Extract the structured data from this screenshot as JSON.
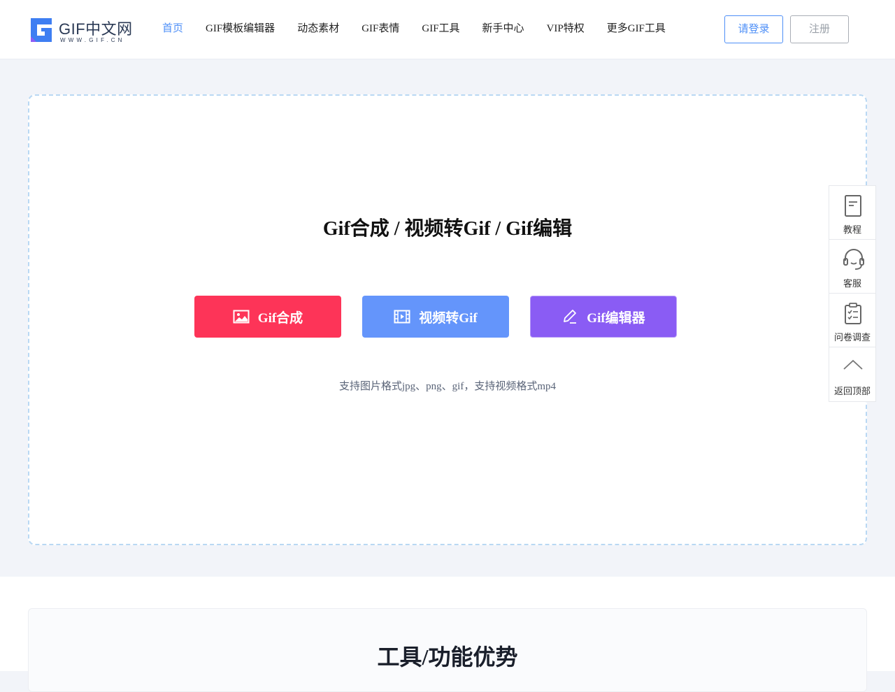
{
  "header": {
    "logo_text": "GIF中文网",
    "logo_sub": "WWW.GIF.CN",
    "nav": [
      {
        "label": "首页",
        "active": true
      },
      {
        "label": "GIF模板编辑器"
      },
      {
        "label": "动态素材"
      },
      {
        "label": "GIF表情"
      },
      {
        "label": "GIF工具"
      },
      {
        "label": "新手中心"
      },
      {
        "label": "VIP特权"
      },
      {
        "label": "更多GIF工具"
      }
    ],
    "login_label": "请登录",
    "register_label": "注册"
  },
  "upload": {
    "title": "Gif合成 / 视频转Gif / Gif编辑",
    "buttons": [
      {
        "label": "Gif合成",
        "icon": "image-icon",
        "color": "#fd3458"
      },
      {
        "label": "视频转Gif",
        "icon": "film-icon",
        "color": "#6495fb"
      },
      {
        "label": "Gif编辑器",
        "icon": "pencil-icon",
        "color": "#8a5cf4"
      }
    ],
    "hint": "支持图片格式jpg、png、gif，支持视频格式mp4"
  },
  "float_bar": {
    "items": [
      {
        "label": "教程",
        "icon": "document-icon"
      },
      {
        "label": "客服",
        "icon": "headset-icon"
      },
      {
        "label": "问卷调查",
        "icon": "clipboard-check-icon"
      },
      {
        "label": "返回顶部",
        "icon": "chevron-up-icon"
      }
    ]
  },
  "features": {
    "title": "工具/功能优势"
  },
  "colors": {
    "accent": "#4e8ff7",
    "compose": "#fd3458",
    "video": "#6495fb",
    "editor": "#8a5cf4"
  }
}
